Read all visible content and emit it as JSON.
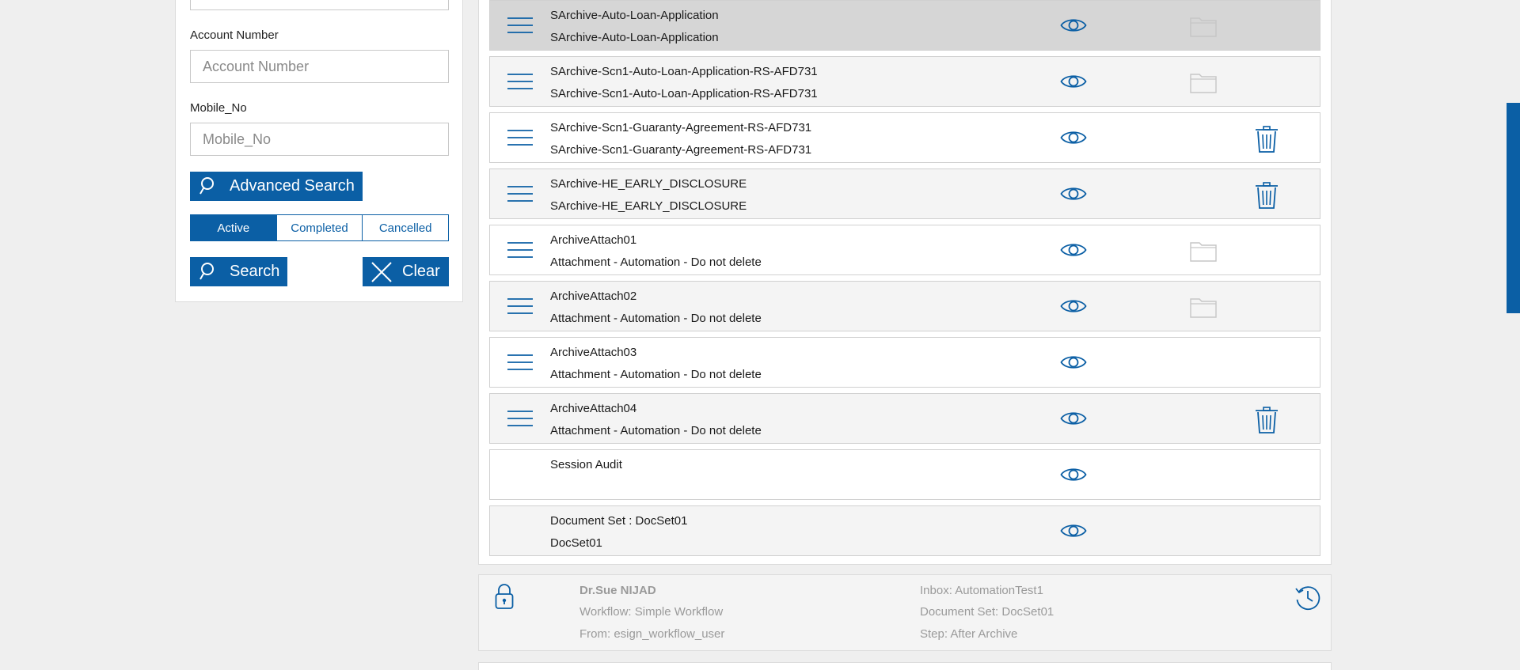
{
  "search_panel": {
    "account_number": {
      "label": "Account Number",
      "placeholder": "Account Number"
    },
    "mobile_no": {
      "label": "Mobile_No",
      "placeholder": "Mobile_No"
    },
    "advanced_search_label": "Advanced Search",
    "status_filter": {
      "options": [
        "Active",
        "Completed",
        "Cancelled"
      ],
      "selected": "Active"
    },
    "search_label": "Search",
    "clear_label": "Clear"
  },
  "documents": [
    {
      "title": "SArchive-Auto-Loan-Application",
      "subtitle": "SArchive-Auto-Loan-Application",
      "has_menu": true,
      "action": "folder",
      "state": "selected"
    },
    {
      "title": "SArchive-Scn1-Auto-Loan-Application-RS-AFD731",
      "subtitle": "SArchive-Scn1-Auto-Loan-Application-RS-AFD731",
      "has_menu": true,
      "action": "folder",
      "state": "alt"
    },
    {
      "title": "SArchive-Scn1-Guaranty-Agreement-RS-AFD731",
      "subtitle": "SArchive-Scn1-Guaranty-Agreement-RS-AFD731",
      "has_menu": true,
      "action": "trash",
      "state": "normal"
    },
    {
      "title": "SArchive-HE_EARLY_DISCLOSURE",
      "subtitle": "SArchive-HE_EARLY_DISCLOSURE",
      "has_menu": true,
      "action": "trash",
      "state": "alt"
    },
    {
      "title": "ArchiveAttach01",
      "subtitle": "Attachment - Automation - Do not delete",
      "has_menu": true,
      "action": "folder",
      "state": "normal"
    },
    {
      "title": "ArchiveAttach02",
      "subtitle": "Attachment - Automation - Do not delete",
      "has_menu": true,
      "action": "folder",
      "state": "alt"
    },
    {
      "title": "ArchiveAttach03",
      "subtitle": "Attachment - Automation - Do not delete",
      "has_menu": true,
      "action": "none",
      "state": "normal"
    },
    {
      "title": "ArchiveAttach04",
      "subtitle": "Attachment - Automation - Do not delete",
      "has_menu": true,
      "action": "trash",
      "state": "alt"
    },
    {
      "title": "Session Audit",
      "subtitle": "",
      "has_menu": false,
      "action": "none",
      "state": "normal"
    },
    {
      "title": "Document Set : DocSet01",
      "subtitle": "DocSet01",
      "has_menu": false,
      "action": "none",
      "state": "alt"
    }
  ],
  "workflow_card": {
    "user": "Dr.Sue NIJAD",
    "workflow": "Workflow: Simple Workflow",
    "from": "From: esign_workflow_user",
    "inbox": "Inbox: AutomationTest1",
    "document_set": "Document Set: DocSet01",
    "step": "Step: After Archive"
  },
  "colors": {
    "accent": "#0b5fa5",
    "selected_row": "#d6d6d6",
    "alt_row": "#f4f4f4",
    "muted_text": "#9a9a9a"
  },
  "icons": {
    "row_menu": "hamburger-icon",
    "row_view": "eye-icon",
    "row_folder": "folder-icon",
    "row_delete": "trash-icon",
    "card_lock": "lock-icon",
    "card_history": "history-icon",
    "search": "magnifier-icon",
    "clear": "close-icon"
  }
}
